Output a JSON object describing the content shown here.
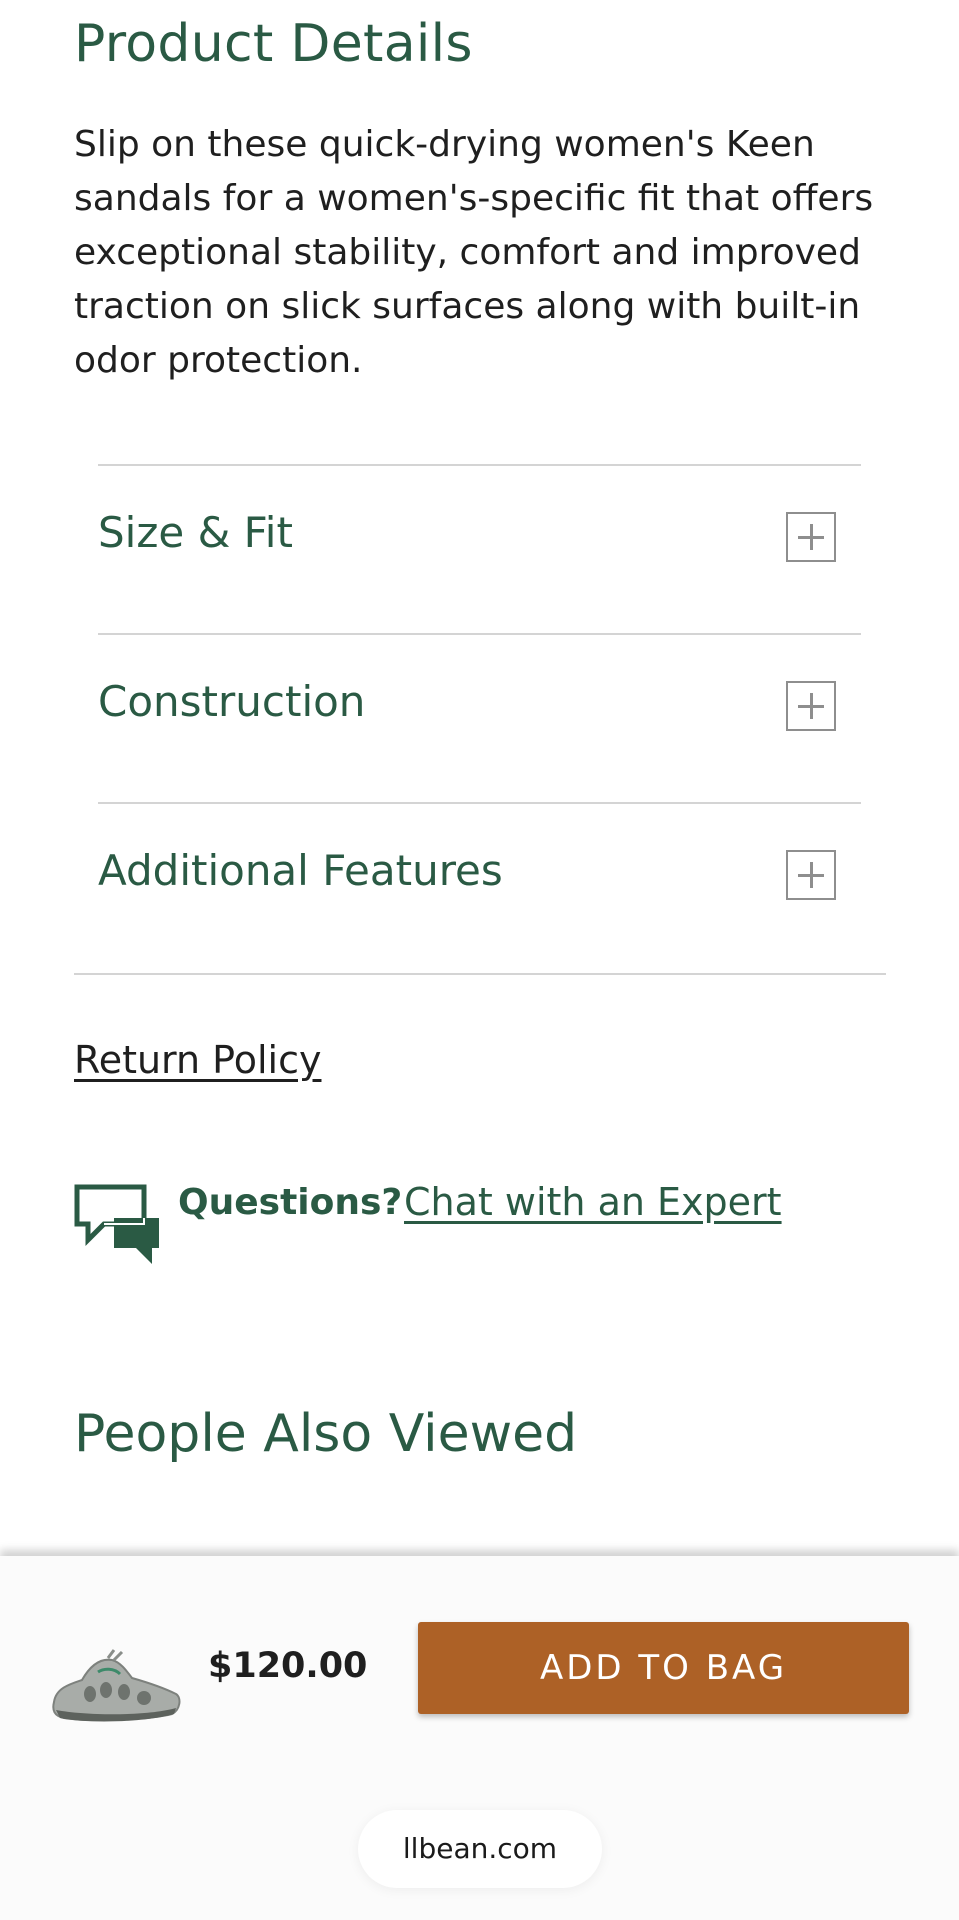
{
  "product_details": {
    "title": "Product Details",
    "description": "Slip on these quick-drying women's Keen sandals for a women's-specific fit that offers exceptional stability, comfort and improved traction on slick surfaces along with built-in odor protection."
  },
  "accordion": {
    "items": [
      {
        "label": "Size & Fit",
        "icon": "plus-icon"
      },
      {
        "label": "Construction",
        "icon": "plus-icon"
      },
      {
        "label": "Additional Features",
        "icon": "plus-icon"
      }
    ]
  },
  "links": {
    "return_policy": "Return Policy"
  },
  "chat": {
    "icon": "chat-bubbles-icon",
    "questions_label": "Questions?",
    "link_label": "Chat with an Expert"
  },
  "people_also_viewed": {
    "title": "People Also Viewed"
  },
  "bottom_bar": {
    "price": "$120.00",
    "add_to_bag_label": "ADD TO BAG",
    "product_image": "sandal-thumbnail"
  },
  "browser": {
    "url": "llbean.com"
  },
  "colors": {
    "brand_green": "#2a5a44",
    "button_orange": "#ad6126",
    "divider": "#d4d4d4"
  }
}
